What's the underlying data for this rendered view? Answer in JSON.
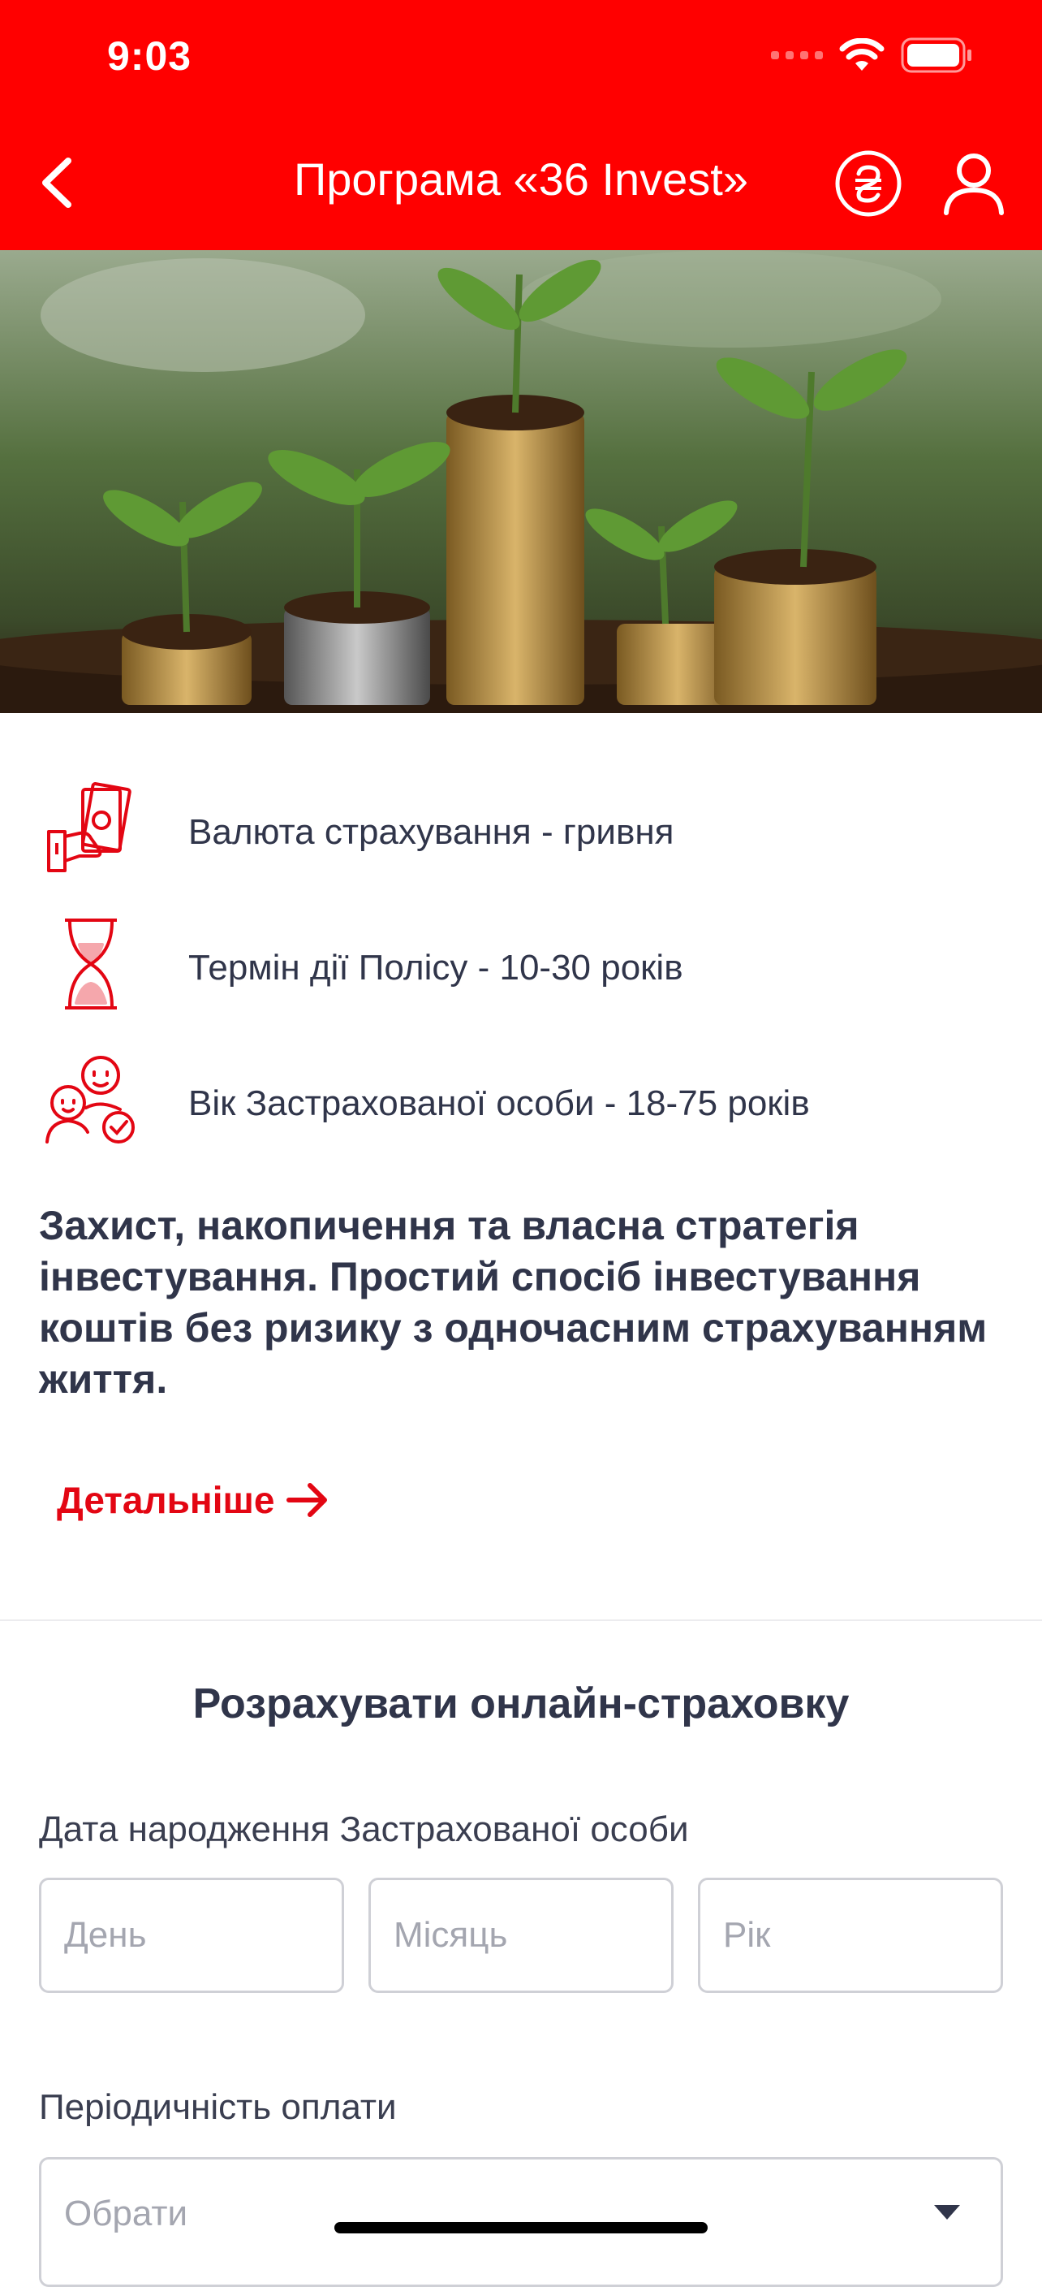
{
  "status_bar": {
    "time": "9:03"
  },
  "nav": {
    "title": "Програма «36 Invest»"
  },
  "features": [
    {
      "icon": "money-hand-icon",
      "text": "Валюта страхування - гривня"
    },
    {
      "icon": "hourglass-icon",
      "text": "Термін дії Полісу  - 10-30 років"
    },
    {
      "icon": "people-check-icon",
      "text": "Вік Застрахованої особи - 18-75 років"
    }
  ],
  "headline": "Захист, накопичення та власна стратегія інвестування. Простий спосіб інвестування коштів без ризику з одночасним страхуванням життя.",
  "more_link": "Детальніше",
  "calculator": {
    "title": "Розрахувати онлайн-страховку",
    "birth_label": "Дата народження Застрахованої особи",
    "day_placeholder": "День",
    "month_placeholder": "Місяць",
    "year_placeholder": "Рік",
    "period_label": "Періодичність оплати",
    "period_placeholder": "Обрати"
  },
  "colors": {
    "brand_red": "#ff0000",
    "link_red": "#e30613",
    "text_dark": "#30354a"
  }
}
